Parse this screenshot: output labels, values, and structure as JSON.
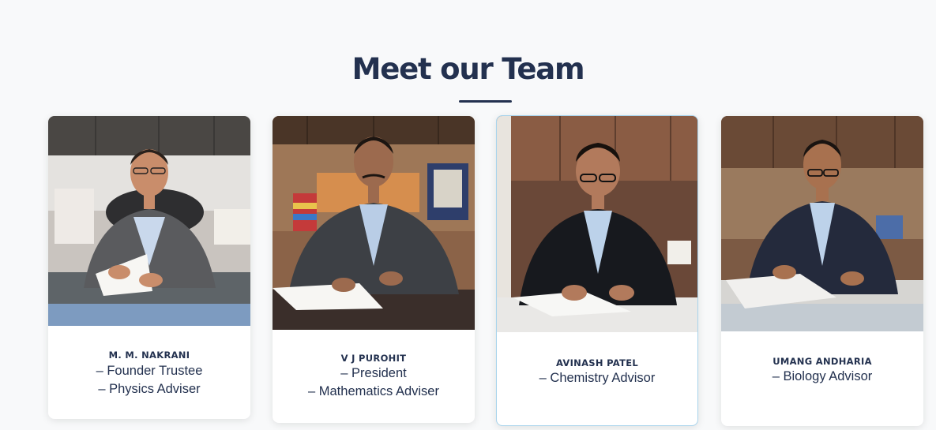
{
  "section": {
    "title": "Meet our Team"
  },
  "team": [
    {
      "name": "M. M. NAKRANI",
      "roles": [
        "– Founder Trustee",
        "– Physics Adviser"
      ]
    },
    {
      "name": "V J PUROHIT",
      "roles": [
        "– President",
        "– Mathematics Adviser"
      ]
    },
    {
      "name": "AVINASH PATEL",
      "roles": [
        "– Chemistry Advisor"
      ]
    },
    {
      "name": "UMANG ANDHARIA",
      "roles": [
        "– Biology Advisor"
      ]
    }
  ],
  "colors": {
    "heading": "#23314f",
    "background": "#f8f9fa",
    "card": "#ffffff",
    "active_border": "#a9d4ec"
  }
}
